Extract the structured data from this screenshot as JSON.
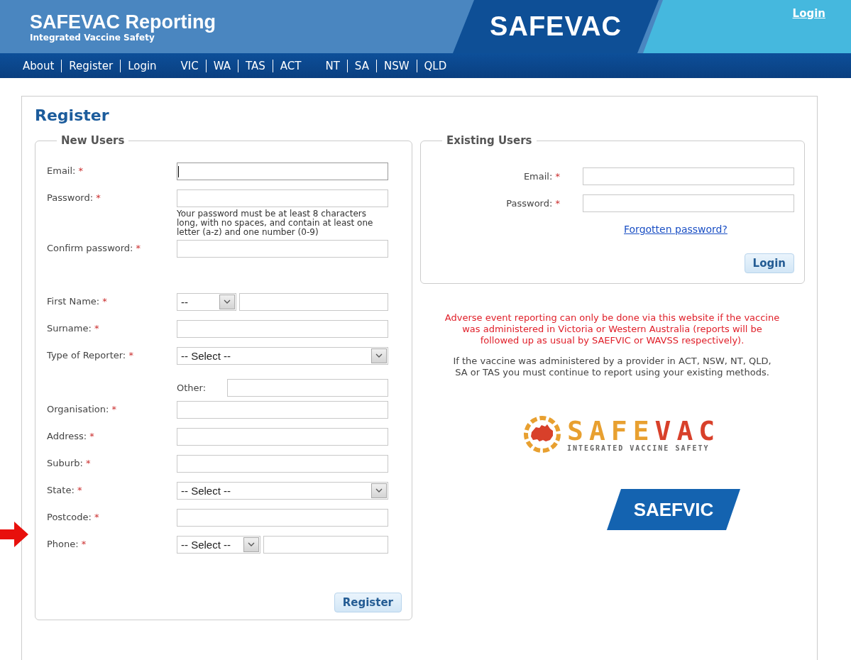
{
  "header": {
    "title": "SAFEVAC Reporting",
    "subtitle": "Integrated Vaccine Safety",
    "logo_text": "SAFEVAC",
    "login_link": "Login"
  },
  "nav": [
    [
      "About",
      "Register",
      "Login"
    ],
    [
      "VIC",
      "WA",
      "TAS",
      "ACT"
    ],
    [
      "NT",
      "SA",
      "NSW",
      "QLD"
    ]
  ],
  "page_title": "Register",
  "new_users": {
    "legend": "New Users",
    "fields": [
      {
        "kind": "text",
        "label": "Email:",
        "mark": "*",
        "focused": true
      },
      {
        "kind": "text",
        "label": "Password:",
        "mark": "*",
        "focused": false,
        "hint": "Your password must be at least 8 characters long, with no spaces, and contain at least one letter (a-z) and one number (0-9)"
      },
      {
        "kind": "text",
        "label": "Confirm password:",
        "mark": "*",
        "focused": false
      },
      {
        "kind": "spacer"
      },
      {
        "kind": "combo",
        "label": "First Name:",
        "mark": "*",
        "focused": false,
        "select_value": "--"
      },
      {
        "kind": "text",
        "label": "Surname:",
        "mark": "*",
        "focused": false
      },
      {
        "kind": "select",
        "label": "Type of Reporter:",
        "mark": "*",
        "select_value": "-- Select --"
      },
      {
        "kind": "other",
        "label": "Other:",
        "focused": false
      },
      {
        "kind": "text",
        "label": "Organisation:",
        "mark": "*",
        "focused": false
      },
      {
        "kind": "text",
        "label": "Address:",
        "mark": "*",
        "focused": false
      },
      {
        "kind": "text",
        "label": "Suburb:",
        "mark": "*",
        "focused": false
      },
      {
        "kind": "select",
        "label": "State:",
        "mark": "*",
        "select_value": "-- Select --"
      },
      {
        "kind": "text",
        "label": "Postcode:",
        "mark": "*",
        "focused": false
      },
      {
        "kind": "phone",
        "label": "Phone:",
        "mark": "*",
        "focused": false,
        "select_value": "-- Select --"
      }
    ],
    "button": "Register"
  },
  "existing_users": {
    "legend": "Existing Users",
    "fields": [
      {
        "label": "Email:",
        "mark": "*"
      },
      {
        "label": "Password:",
        "mark": "*"
      }
    ],
    "link": "Forgotten password?",
    "button": "Login"
  },
  "notice": "Adverse event reporting can only be done via this website if the vaccine was administered in Victoria or Western Australia (reports will be followed up as usual by SAEFVIC or WAVSS respectively).",
  "info": "If the vaccine was administered by a provider in ACT, NSW, NT, QLD, SA or TAS you must continue to report using your existing methods.",
  "safevac_logo": {
    "name": "SAFEVAC",
    "tagline": "INTEGRATED VACCINE SAFETY"
  },
  "saefvic_logo": {
    "name": "SAEFVIC"
  }
}
